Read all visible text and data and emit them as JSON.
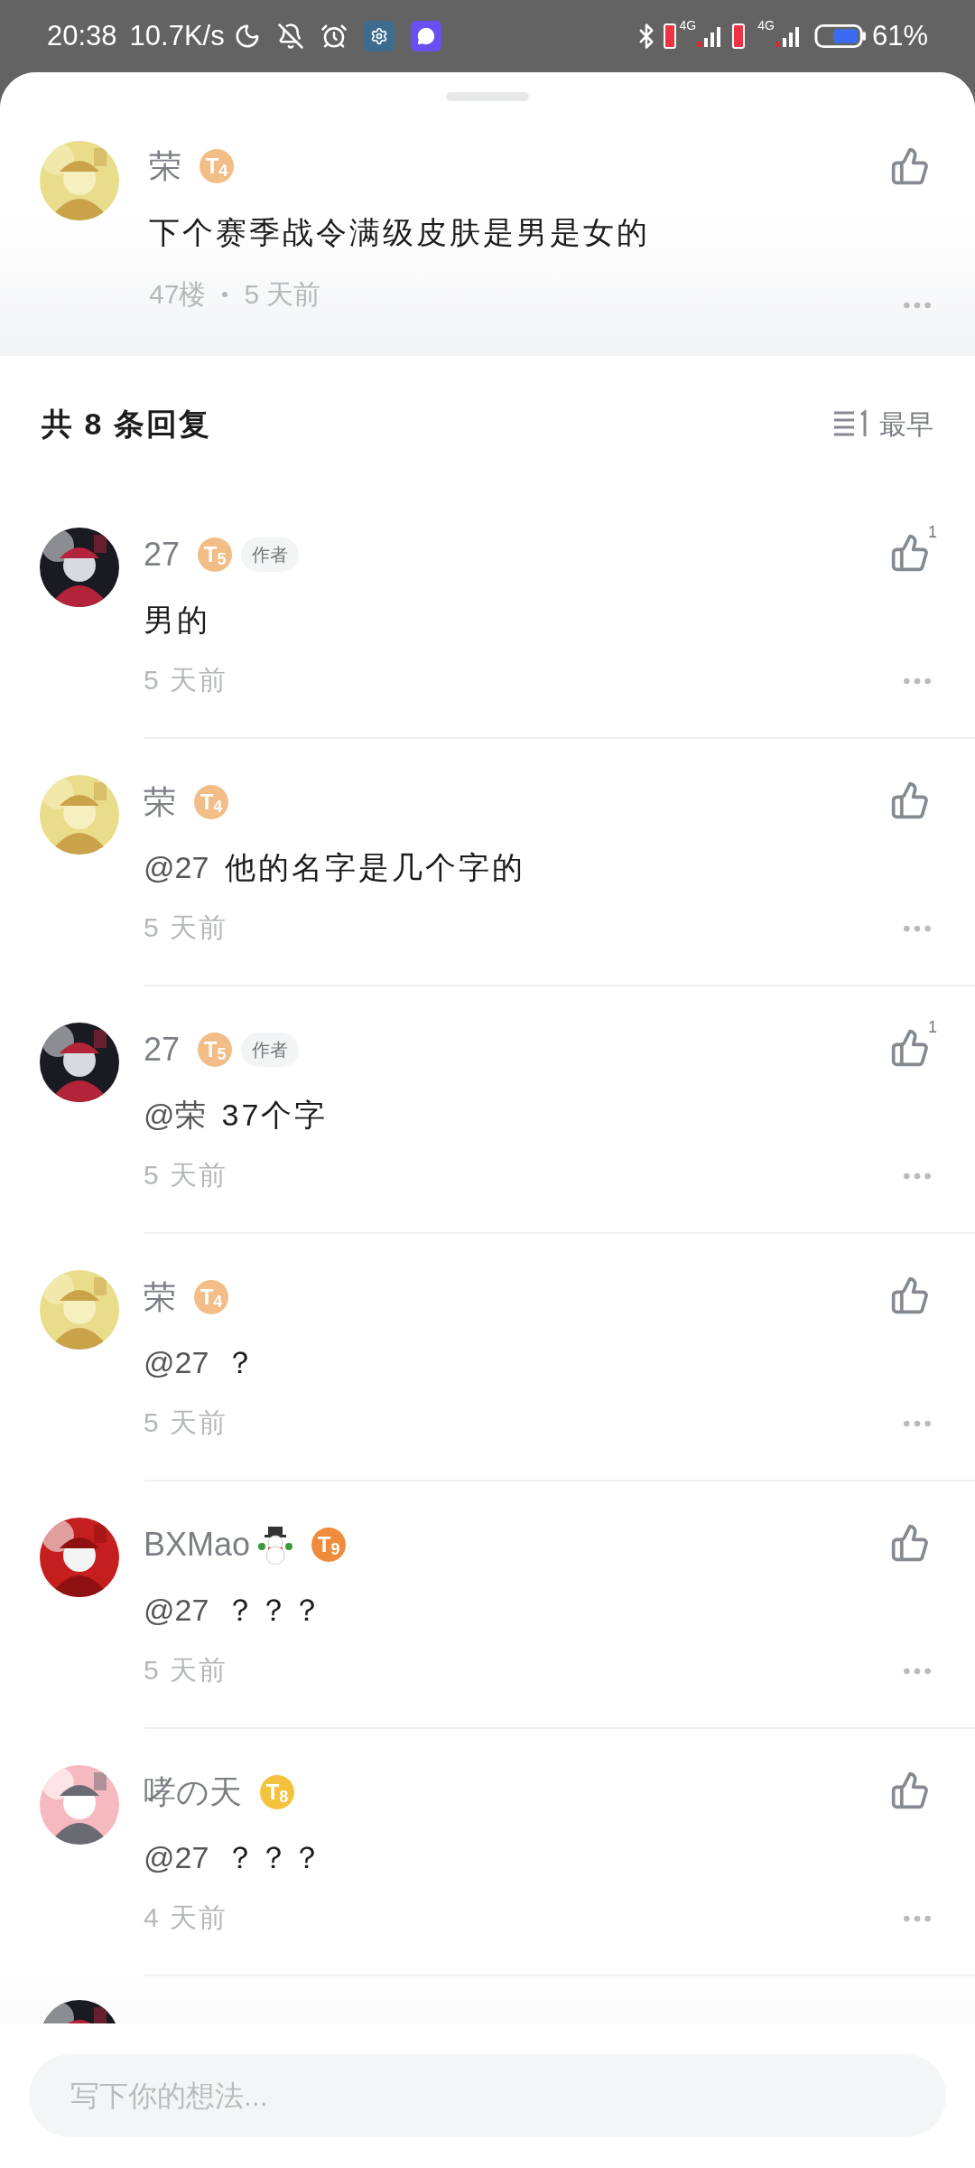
{
  "status_bar": {
    "time": "20:38",
    "speed": "10.7K/s",
    "sim1_network": "4G",
    "sim2_network": "4G",
    "battery": "61%"
  },
  "post": {
    "author": "荣",
    "level": "T$_{4}$",
    "color": "#f2bd86",
    "content": "下个赛季战令满级皮肤是男是女的",
    "floor": "47楼",
    "time": "5 天前"
  },
  "replies_header": {
    "title": "共 8 条回复",
    "sort": "最早"
  },
  "replies": [
    {
      "author": "27",
      "level": "T$_{5}$",
      "color": "#f2bd86",
      "tag": "作者",
      "text": "男的",
      "time": "5 天前",
      "likes": "1"
    },
    {
      "author": "荣",
      "level": "T$_{4}$",
      "color": "#f2bd86",
      "mention": "@27",
      "text": "他的名字是几个字的",
      "time": "5 天前"
    },
    {
      "author": "27",
      "level": "T$_{5}$",
      "color": "#f2bd86",
      "tag": "作者",
      "mention": "@荣",
      "text": "37个字",
      "time": "5 天前",
      "likes": "1"
    },
    {
      "author": "荣",
      "level": "T$_{4}$",
      "color": "#f2bd86",
      "mention": "@27",
      "text": "？",
      "time": "5 天前"
    },
    {
      "author": "BXMao",
      "name_icon": true,
      "level": "T$_{9}$",
      "color": "#f08b3c",
      "mention": "@27",
      "text": "？？？",
      "time": "5 天前"
    },
    {
      "author": "哮の天",
      "level": "T$_{8}$",
      "color": "#f4c23c",
      "mention": "@27",
      "text": "？？？",
      "time": "4 天前"
    }
  ],
  "input": {
    "placeholder": "写下你的想法..."
  }
}
